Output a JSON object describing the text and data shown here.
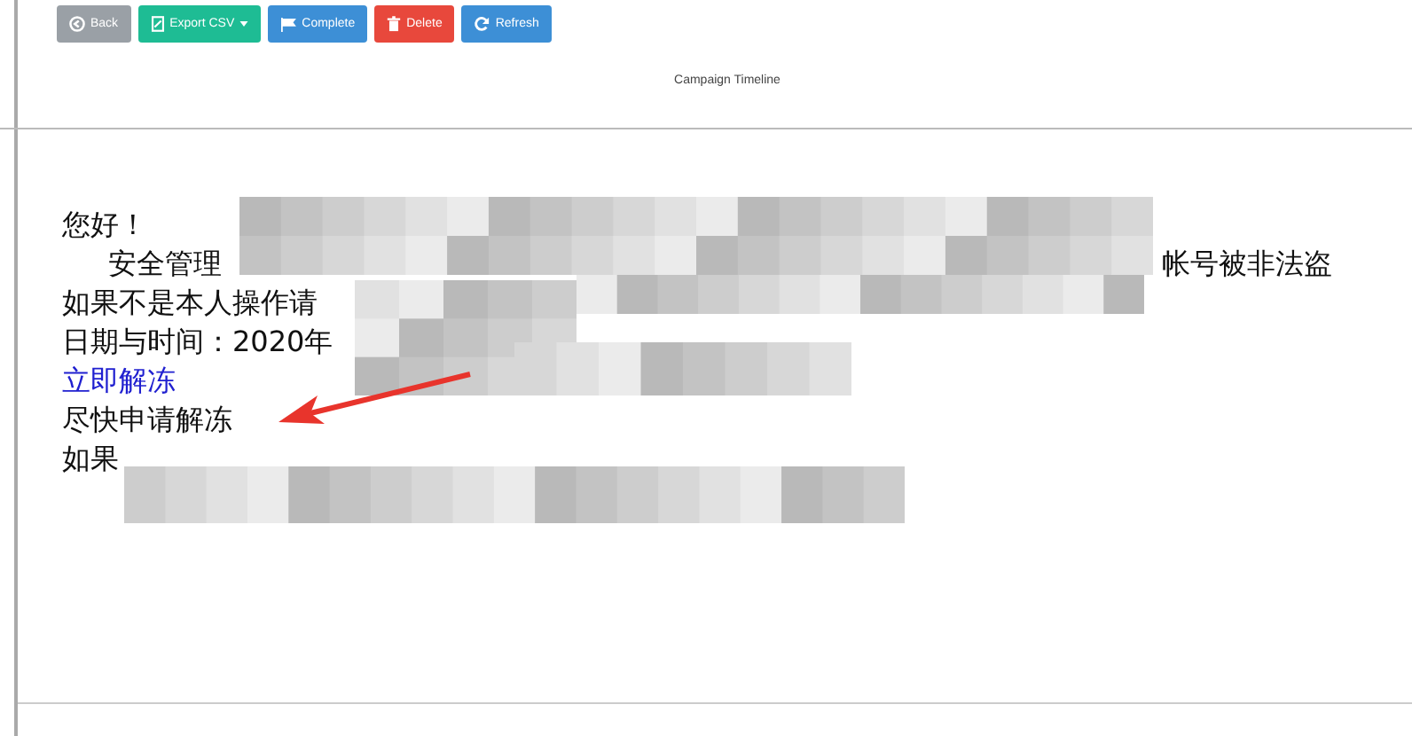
{
  "toolbar": {
    "buttons": [
      {
        "label": "Back",
        "kind": "back",
        "disabled": true
      },
      {
        "label": "Export CSV",
        "kind": "export",
        "disabled": false
      },
      {
        "label": "Complete",
        "kind": "complete",
        "disabled": false
      },
      {
        "label": "Delete",
        "kind": "delete",
        "disabled": false
      },
      {
        "label": "Refresh",
        "kind": "refresh",
        "disabled": false
      }
    ]
  },
  "timeline": {
    "title": "Campaign Timeline"
  },
  "email": {
    "lines": [
      {
        "text": "您好！",
        "kind": "text"
      },
      {
        "text": "安全管理",
        "kind": "indent",
        "tail": "帐号被非法盗"
      },
      {
        "text": "如果不是本人操作请",
        "kind": "text"
      },
      {
        "text": "日期与时间：2020年",
        "kind": "text"
      },
      {
        "text": "立即解冻",
        "kind": "link"
      },
      {
        "text": "尽快申请解冻",
        "kind": "text"
      },
      {
        "text": "如果",
        "kind": "text"
      }
    ]
  }
}
